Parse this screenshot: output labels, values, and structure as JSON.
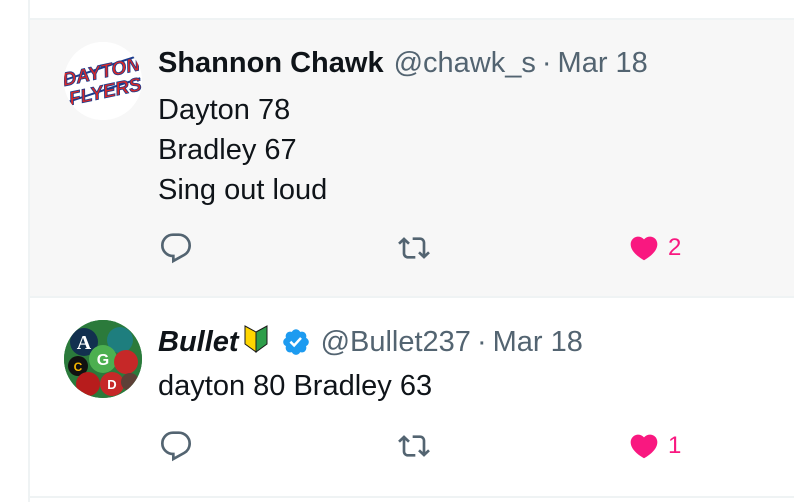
{
  "tweets": [
    {
      "author": "Shannon Chawk",
      "handle": "@chawk_s",
      "separator": "·",
      "date": "Mar 18",
      "avatar_text_1": "DAYTON",
      "avatar_text_2": "FLYERS",
      "lines": [
        "Dayton 78",
        "Bradley 67",
        "Sing out loud"
      ],
      "like_count": "2",
      "liked": true
    },
    {
      "author": "Bullet",
      "handle": "@Bullet237",
      "separator": "·",
      "date": "Mar 18",
      "verified": true,
      "badge_icon": "beginner-leaf-icon",
      "lines": [
        "dayton 80 Bradley 63"
      ],
      "like_count": "1",
      "liked": true
    }
  ],
  "colors": {
    "like": "#f91880",
    "icon": "#536471",
    "verified": "#1d9bf0",
    "divider": "#eff3f4"
  }
}
